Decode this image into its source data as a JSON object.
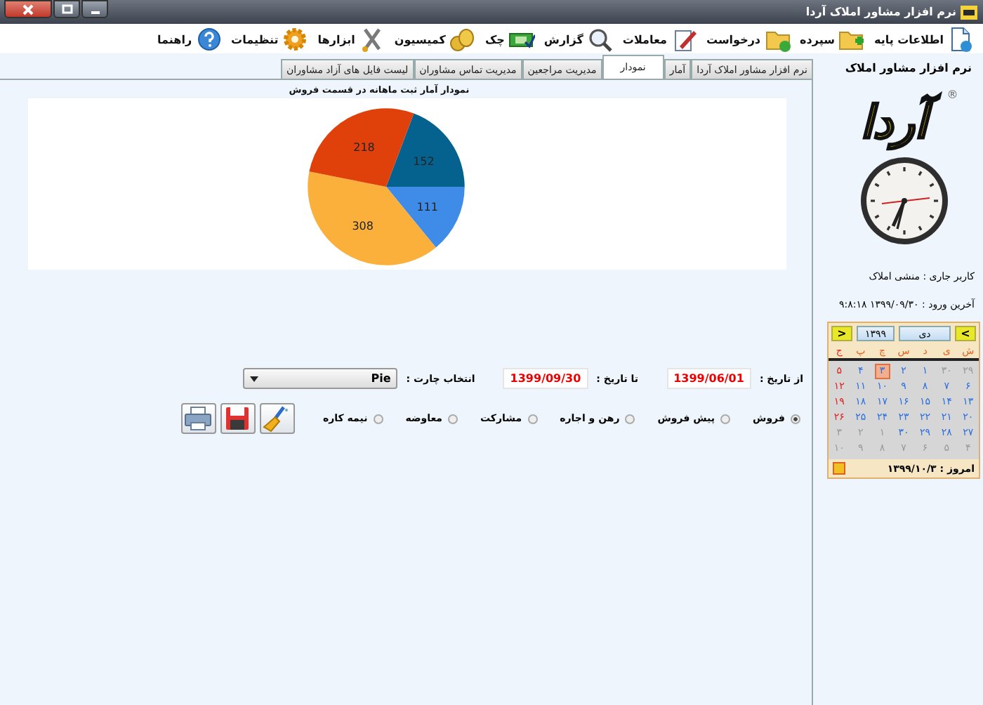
{
  "window": {
    "title": "نرم افزار مشاور املاک آردا"
  },
  "toolbar": [
    {
      "label": "اطلاعات پایه"
    },
    {
      "label": "سپرده"
    },
    {
      "label": "درخواست"
    },
    {
      "label": "معاملات"
    },
    {
      "label": "گزارش"
    },
    {
      "label": "چک"
    },
    {
      "label": "کمیسیون"
    },
    {
      "label": "ابزارها"
    },
    {
      "label": "تنظیمات"
    },
    {
      "label": "راهنما"
    }
  ],
  "tabs": [
    {
      "label": "نرم افزار مشاور املاک آردا",
      "selected": false
    },
    {
      "label": "آمار",
      "selected": false
    },
    {
      "label": "نمودار",
      "selected": true
    },
    {
      "label": "مدیریت مراجعین",
      "selected": false
    },
    {
      "label": "مدیریت تماس مشاوران",
      "selected": false
    },
    {
      "label": "لیست فایل های آزاد مشاوران",
      "selected": false
    }
  ],
  "chart": {
    "chart_data": {
      "type": "pie",
      "title": "نمودار آمار ثبت ماهانه در قسمت فروش",
      "values": [
        152,
        111,
        308,
        218
      ],
      "data_labels": true
    }
  },
  "filters": {
    "from_label": "از تاریخ :",
    "from_value": "1399/06/01",
    "to_label": "تا تاریخ :",
    "to_value": "1399/09/30",
    "chart_label": "انتخاب چارت :",
    "chart_value": "Pie"
  },
  "categories": [
    {
      "label": "فروش",
      "selected": true
    },
    {
      "label": "پیش فروش",
      "selected": false
    },
    {
      "label": "رهن و اجاره",
      "selected": false
    },
    {
      "label": "مشارکت",
      "selected": false
    },
    {
      "label": "معاوضه",
      "selected": false
    },
    {
      "label": "نیمه کاره",
      "selected": false
    }
  ],
  "sidebar": {
    "title": "نرم افزار مشاور املاک",
    "logo": "آردا",
    "registered": "®",
    "user": "کاربر جاری : منشی املاک",
    "last_login": "آخرین ورود : ۱۳۹۹/۰۹/۳۰ ۹:۸:۱۸"
  },
  "calendar": {
    "prev": "<",
    "next": ">",
    "month": "دی",
    "year": "۱۳۹۹",
    "weekdays": [
      {
        "label": "ش",
        "holiday": false
      },
      {
        "label": "ی",
        "holiday": false
      },
      {
        "label": "د",
        "holiday": false
      },
      {
        "label": "س",
        "holiday": false
      },
      {
        "label": "چ",
        "holiday": false
      },
      {
        "label": "پ",
        "holiday": false
      },
      {
        "label": "ج",
        "holiday": true
      }
    ],
    "weeks": [
      [
        {
          "day": "۲۹",
          "other": true,
          "holiday": false,
          "selected": false
        },
        {
          "day": "۳۰",
          "other": true,
          "holiday": false,
          "selected": false
        },
        {
          "day": "۱",
          "other": false,
          "holiday": false,
          "selected": false
        },
        {
          "day": "۲",
          "other": false,
          "holiday": false,
          "selected": false
        },
        {
          "day": "۳",
          "other": false,
          "holiday": false,
          "selected": true
        },
        {
          "day": "۴",
          "other": false,
          "holiday": false,
          "selected": false
        },
        {
          "day": "۵",
          "other": false,
          "holiday": true,
          "selected": false
        }
      ],
      [
        {
          "day": "۶",
          "other": false,
          "holiday": false,
          "selected": false
        },
        {
          "day": "۷",
          "other": false,
          "holiday": false,
          "selected": false
        },
        {
          "day": "۸",
          "other": false,
          "holiday": false,
          "selected": false
        },
        {
          "day": "۹",
          "other": false,
          "holiday": false,
          "selected": false
        },
        {
          "day": "۱۰",
          "other": false,
          "holiday": false,
          "selected": false
        },
        {
          "day": "۱۱",
          "other": false,
          "holiday": false,
          "selected": false
        },
        {
          "day": "۱۲",
          "other": false,
          "holiday": true,
          "selected": false
        }
      ],
      [
        {
          "day": "۱۳",
          "other": false,
          "holiday": false,
          "selected": false
        },
        {
          "day": "۱۴",
          "other": false,
          "holiday": false,
          "selected": false
        },
        {
          "day": "۱۵",
          "other": false,
          "holiday": false,
          "selected": false
        },
        {
          "day": "۱۶",
          "other": false,
          "holiday": false,
          "selected": false
        },
        {
          "day": "۱۷",
          "other": false,
          "holiday": false,
          "selected": false
        },
        {
          "day": "۱۸",
          "other": false,
          "holiday": false,
          "selected": false
        },
        {
          "day": "۱۹",
          "other": false,
          "holiday": true,
          "selected": false
        }
      ],
      [
        {
          "day": "۲۰",
          "other": false,
          "holiday": false,
          "selected": false
        },
        {
          "day": "۲۱",
          "other": false,
          "holiday": false,
          "selected": false
        },
        {
          "day": "۲۲",
          "other": false,
          "holiday": false,
          "selected": false
        },
        {
          "day": "۲۳",
          "other": false,
          "holiday": false,
          "selected": false
        },
        {
          "day": "۲۴",
          "other": false,
          "holiday": false,
          "selected": false
        },
        {
          "day": "۲۵",
          "other": false,
          "holiday": false,
          "selected": false
        },
        {
          "day": "۲۶",
          "other": false,
          "holiday": true,
          "selected": false
        }
      ],
      [
        {
          "day": "۲۷",
          "other": false,
          "holiday": false,
          "selected": false
        },
        {
          "day": "۲۸",
          "other": false,
          "holiday": false,
          "selected": false
        },
        {
          "day": "۲۹",
          "other": false,
          "holiday": false,
          "selected": false
        },
        {
          "day": "۳۰",
          "other": false,
          "holiday": false,
          "selected": false
        },
        {
          "day": "۱",
          "other": true,
          "holiday": false,
          "selected": false
        },
        {
          "day": "۲",
          "other": true,
          "holiday": false,
          "selected": false
        },
        {
          "day": "۳",
          "other": true,
          "holiday": false,
          "selected": false
        }
      ],
      [
        {
          "day": "۴",
          "other": true,
          "holiday": false,
          "selected": false
        },
        {
          "day": "۵",
          "other": true,
          "holiday": false,
          "selected": false
        },
        {
          "day": "۶",
          "other": true,
          "holiday": false,
          "selected": false
        },
        {
          "day": "۷",
          "other": true,
          "holiday": false,
          "selected": false
        },
        {
          "day": "۸",
          "other": true,
          "holiday": false,
          "selected": false
        },
        {
          "day": "۹",
          "other": true,
          "holiday": false,
          "selected": false
        },
        {
          "day": "۱۰",
          "other": true,
          "holiday": false,
          "selected": false
        }
      ]
    ],
    "today": "امروز : ۱۳۹۹/۱۰/۳"
  }
}
